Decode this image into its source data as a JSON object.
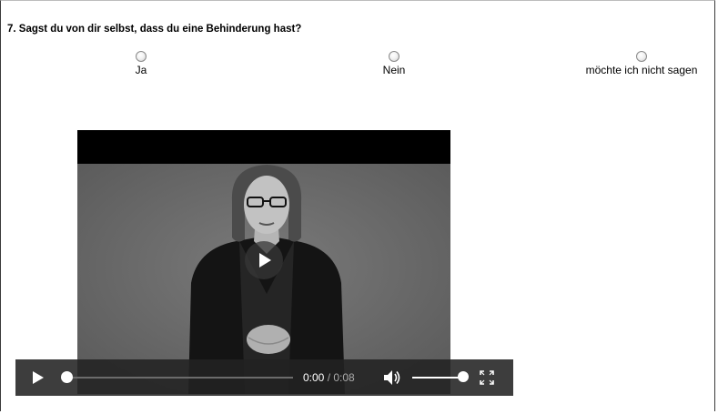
{
  "question": {
    "text": "7. Sagst du von dir selbst, dass du eine Behinderung hast?"
  },
  "options": [
    {
      "label": "Ja",
      "selected": false
    },
    {
      "label": "Nein",
      "selected": false
    },
    {
      "label": "möchte ich nicht sagen",
      "selected": false
    }
  ],
  "video": {
    "current_time": "0:00",
    "separator": " / ",
    "duration": "0:08",
    "progress": 0,
    "volume": 1,
    "state": "paused"
  },
  "icons": {
    "play": "play-icon",
    "volume": "volume-icon",
    "fullscreen": "fullscreen-icon"
  }
}
